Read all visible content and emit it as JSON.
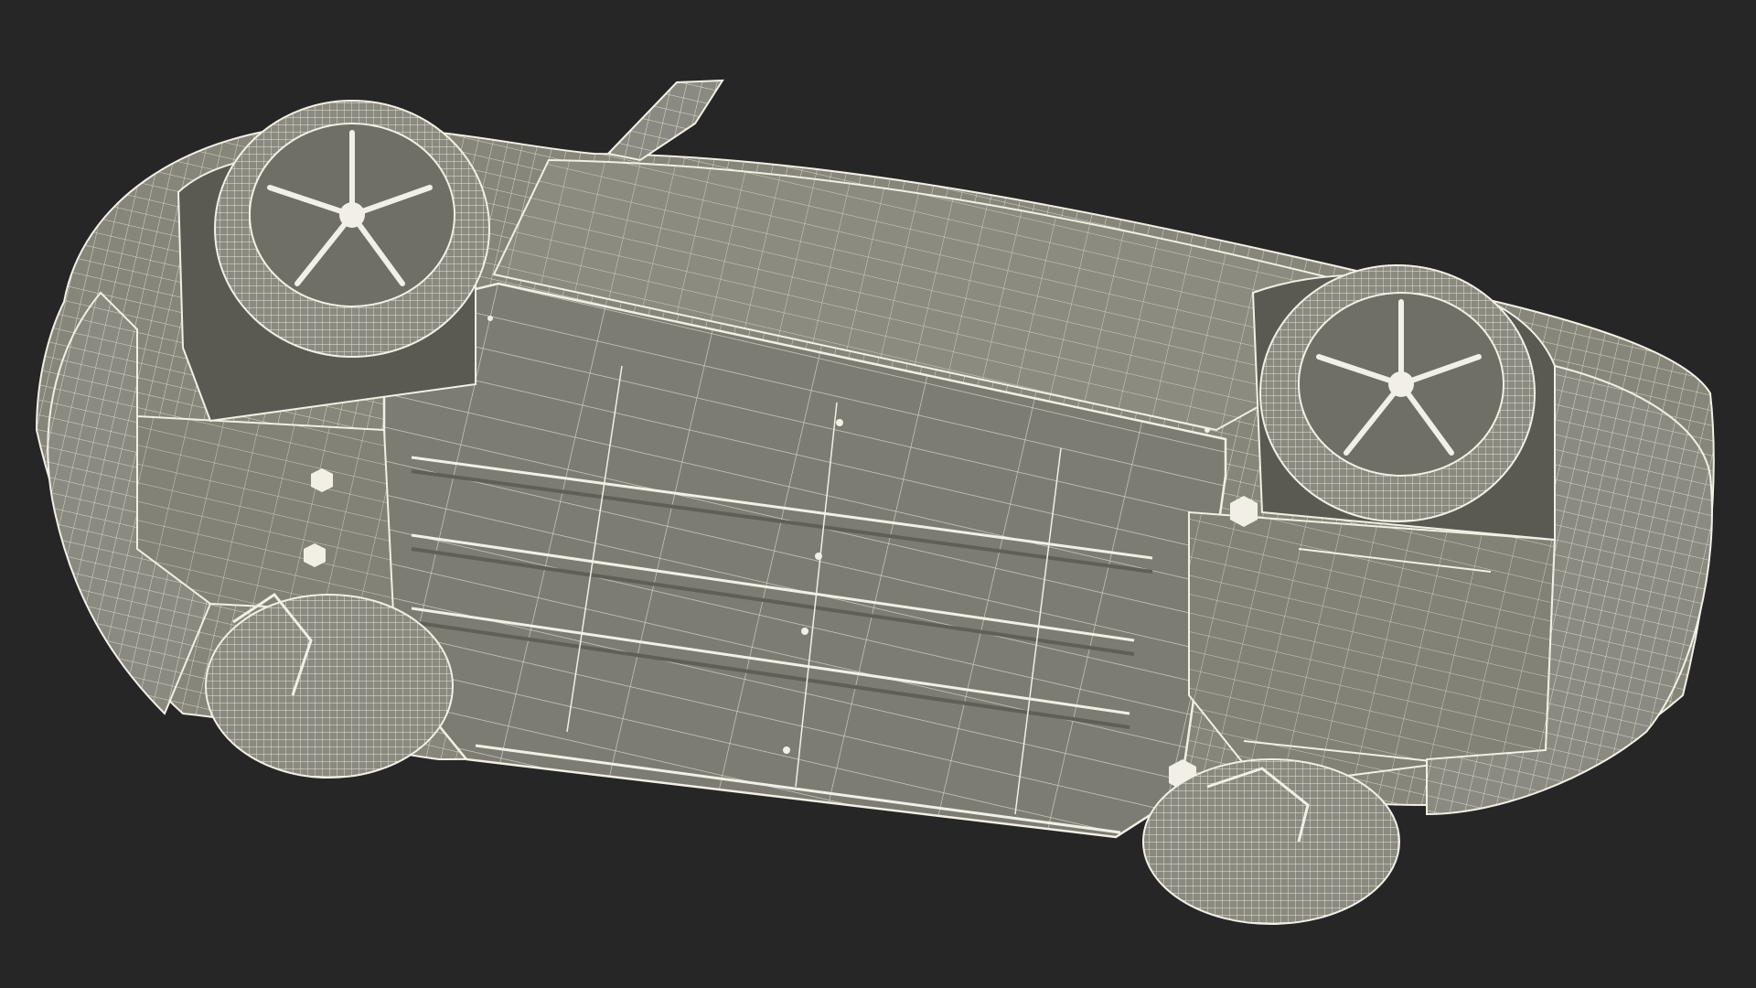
{
  "scene": {
    "subject": "car-underside-wireframe",
    "colors": {
      "background": "#262626",
      "surface_body": "#86867b",
      "surface_panel": "#7b7b71",
      "surface_dark": "#5f5f57",
      "tire": "#8a8a80",
      "wire": "#f2f0e6",
      "wire_dim": "#c9c7bb",
      "shadow": "#4b4b45"
    }
  }
}
